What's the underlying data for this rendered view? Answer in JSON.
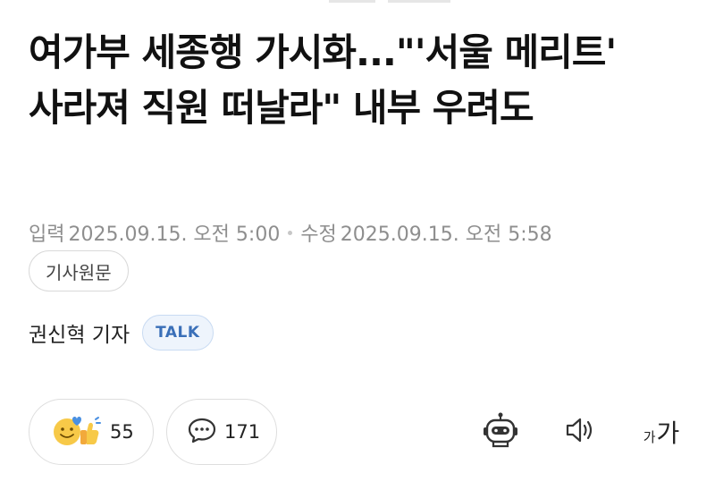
{
  "article": {
    "headline": "여가부 세종행 가시화...\"'서울 메리트' 사라져 직원 떠날라\" 내부 우려도",
    "published_label": "입력",
    "published_at": "2025.09.15. 오전 5:00",
    "modified_label": "수정",
    "modified_at": "2025.09.15. 오전 5:58",
    "source_button": "기사원문",
    "reporter": "권신혁 기자",
    "talk_button": "TALK"
  },
  "actions": {
    "reaction_count": "55",
    "comment_count": "171",
    "reaction_icon": "smile-thumbs-up-icon",
    "comment_icon": "speech-bubble-icon"
  },
  "tools": {
    "robot_icon": "robot-icon",
    "speaker_icon": "speaker-icon",
    "font_small": "가",
    "font_big": "가"
  },
  "colors": {
    "meta_text": "#8e8e8e",
    "talk_accent": "#3a6fb8",
    "reaction_yellow": "#f7c948",
    "reaction_blue": "#4a90e2"
  }
}
